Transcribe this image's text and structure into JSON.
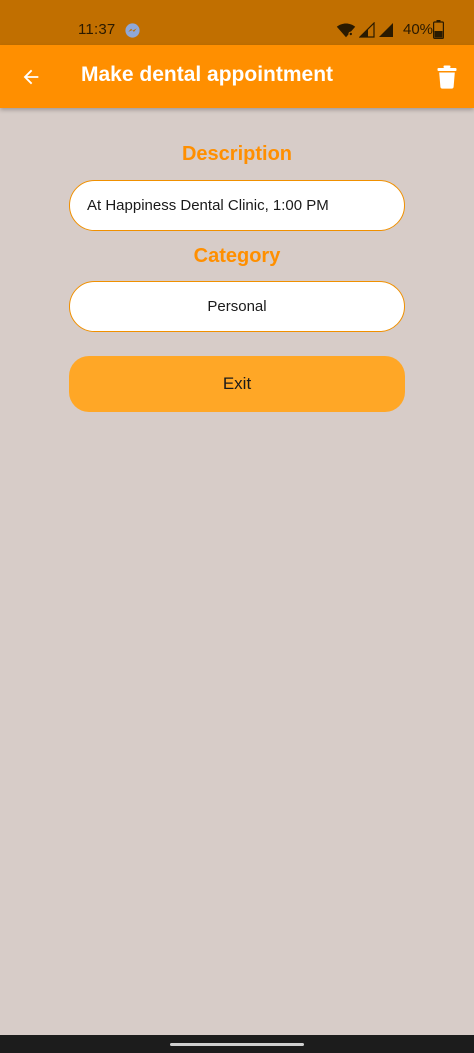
{
  "status_bar": {
    "time": "11:37",
    "battery_percent": "40%",
    "notification_icon": "messenger-icon",
    "icons": [
      "wifi-icon",
      "signal-icon",
      "signal-icon",
      "battery-icon"
    ]
  },
  "app_bar": {
    "title": "Make dental appointment",
    "back_icon": "arrow-left-icon",
    "action_icon": "trash-icon",
    "color": "#ff8f00"
  },
  "form": {
    "description_label": "Description",
    "description_value": "At Happiness Dental Clinic, 1:00 PM",
    "category_label": "Category",
    "category_value": "Personal",
    "exit_label": "Exit"
  },
  "colors": {
    "background": "#d7ccc8",
    "accent": "#ff8f00",
    "button": "#ffa726",
    "status_bar": "#c16f00"
  }
}
